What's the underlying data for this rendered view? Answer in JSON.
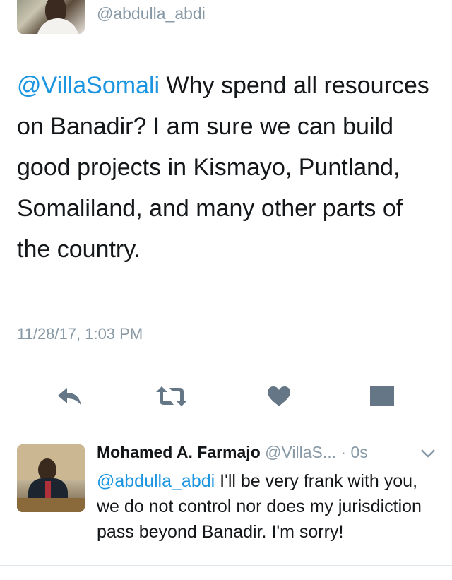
{
  "top_tweet": {
    "handle": "@abdulla_abdi",
    "mention": "@VillaSomali",
    "text": " Why spend all resources on Banadir? I am sure we can build good projects in Kismayo, Puntland, Somaliland, and many other parts of the country.",
    "timestamp": "11/28/17, 1:03 PM"
  },
  "actions": {
    "icons": [
      "reply-icon",
      "retweet-icon",
      "like-icon",
      "direct-message-icon"
    ],
    "color": "#657786"
  },
  "reply": {
    "name": "Mohamed A. Farmajo",
    "handle": "@VillaS...",
    "time": " · 0s",
    "mention": "@abdulla_abdi",
    "text": " I'll be very frank with you, we do not control nor does my jurisdiction pass beyond Banadir. I'm sorry!"
  },
  "colors": {
    "link": "#1b95e0",
    "secondary_text": "#8899a6",
    "primary_text": "#14171a",
    "divider": "#e1e8ed"
  }
}
